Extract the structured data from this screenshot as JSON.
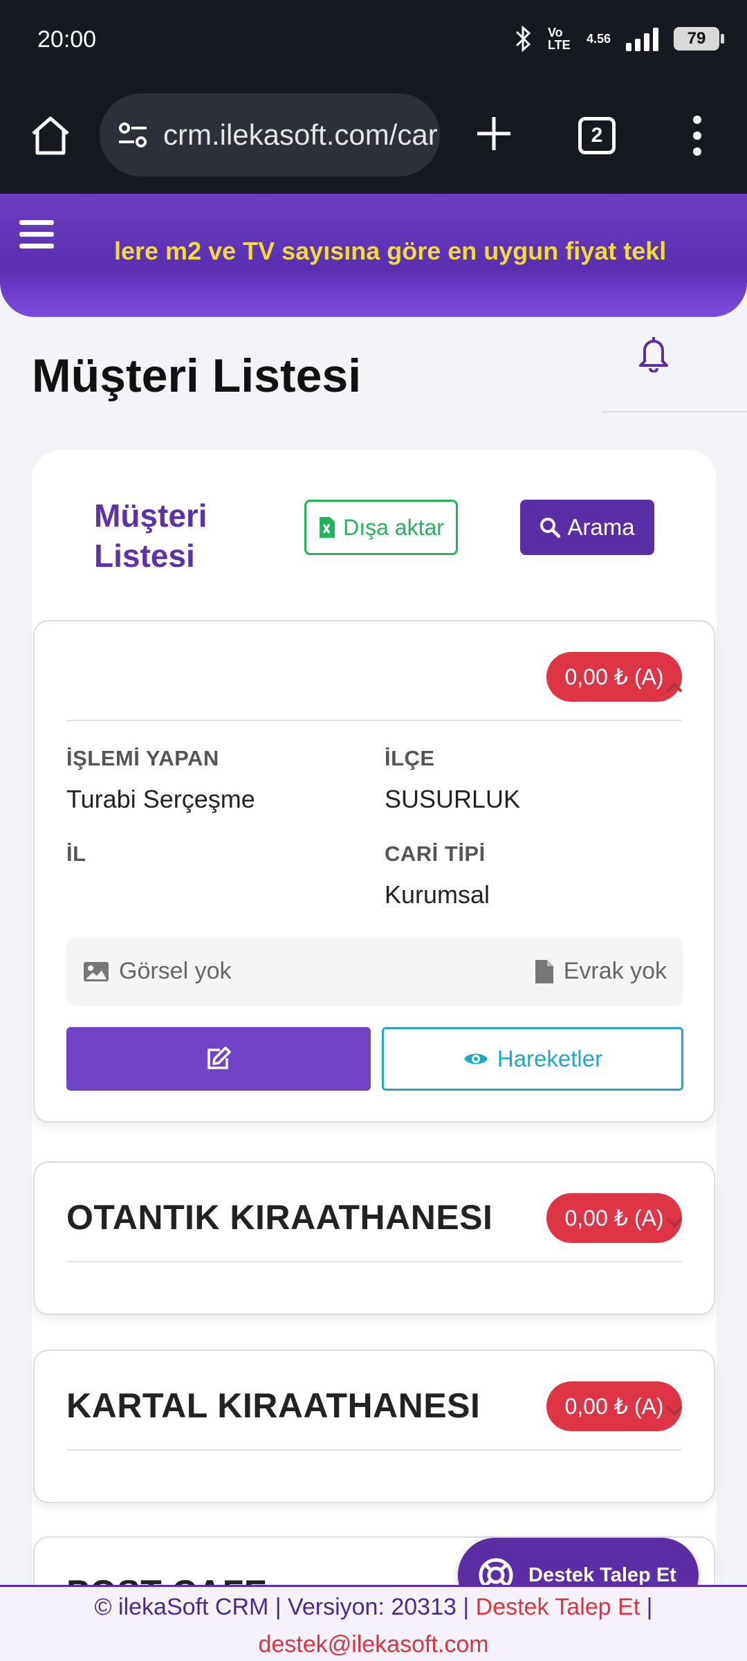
{
  "status_bar": {
    "time": "20:00",
    "network": "Vo LTE",
    "data_speed": "4.56",
    "battery": "79"
  },
  "browser": {
    "url": "crm.ilekasoft.com/car",
    "tab_count": "2"
  },
  "header": {
    "marquee": "lere m2 ve TV sayısına göre en uygun fiyat tekl"
  },
  "page": {
    "title": "Müşteri Listesi"
  },
  "list_header": {
    "title": "Müşteri Listesi",
    "export_label": "Dışa aktar",
    "search_label": "Arama"
  },
  "customers": [
    {
      "name": "",
      "balance": "0,00 ₺ (A)",
      "fields": [
        {
          "label": "İŞLEMİ YAPAN",
          "value": "Turabi Serçeşme"
        },
        {
          "label": "İLÇE",
          "value": "SUSURLUK"
        },
        {
          "label": "İL",
          "value": ""
        },
        {
          "label": "CARİ TİPİ",
          "value": "Kurumsal"
        }
      ],
      "image_status": "Görsel yok",
      "doc_status": "Evrak yok",
      "moves_label": "Hareketler"
    },
    {
      "name": "OTANTIK KIRAATHANESI",
      "balance": "0,00 ₺ (A)"
    },
    {
      "name": "KARTAL KIRAATHANESI",
      "balance": "0,00 ₺ (A)"
    },
    {
      "name": "POST CAFE",
      "balance": ""
    }
  ],
  "support_button": {
    "label": "Destek Talep Et"
  },
  "footer": {
    "text": "© ilekaSoft CRM | Versiyon: 20313 |",
    "support_link": "Destek Talep Et",
    "separator": "|",
    "email": "destek@ilekasoft.com"
  },
  "colors": {
    "brand": "#5b2ea5",
    "danger": "#de3545",
    "success": "#22b45a",
    "info": "#21a9c4",
    "marquee": "#f4d93a"
  }
}
